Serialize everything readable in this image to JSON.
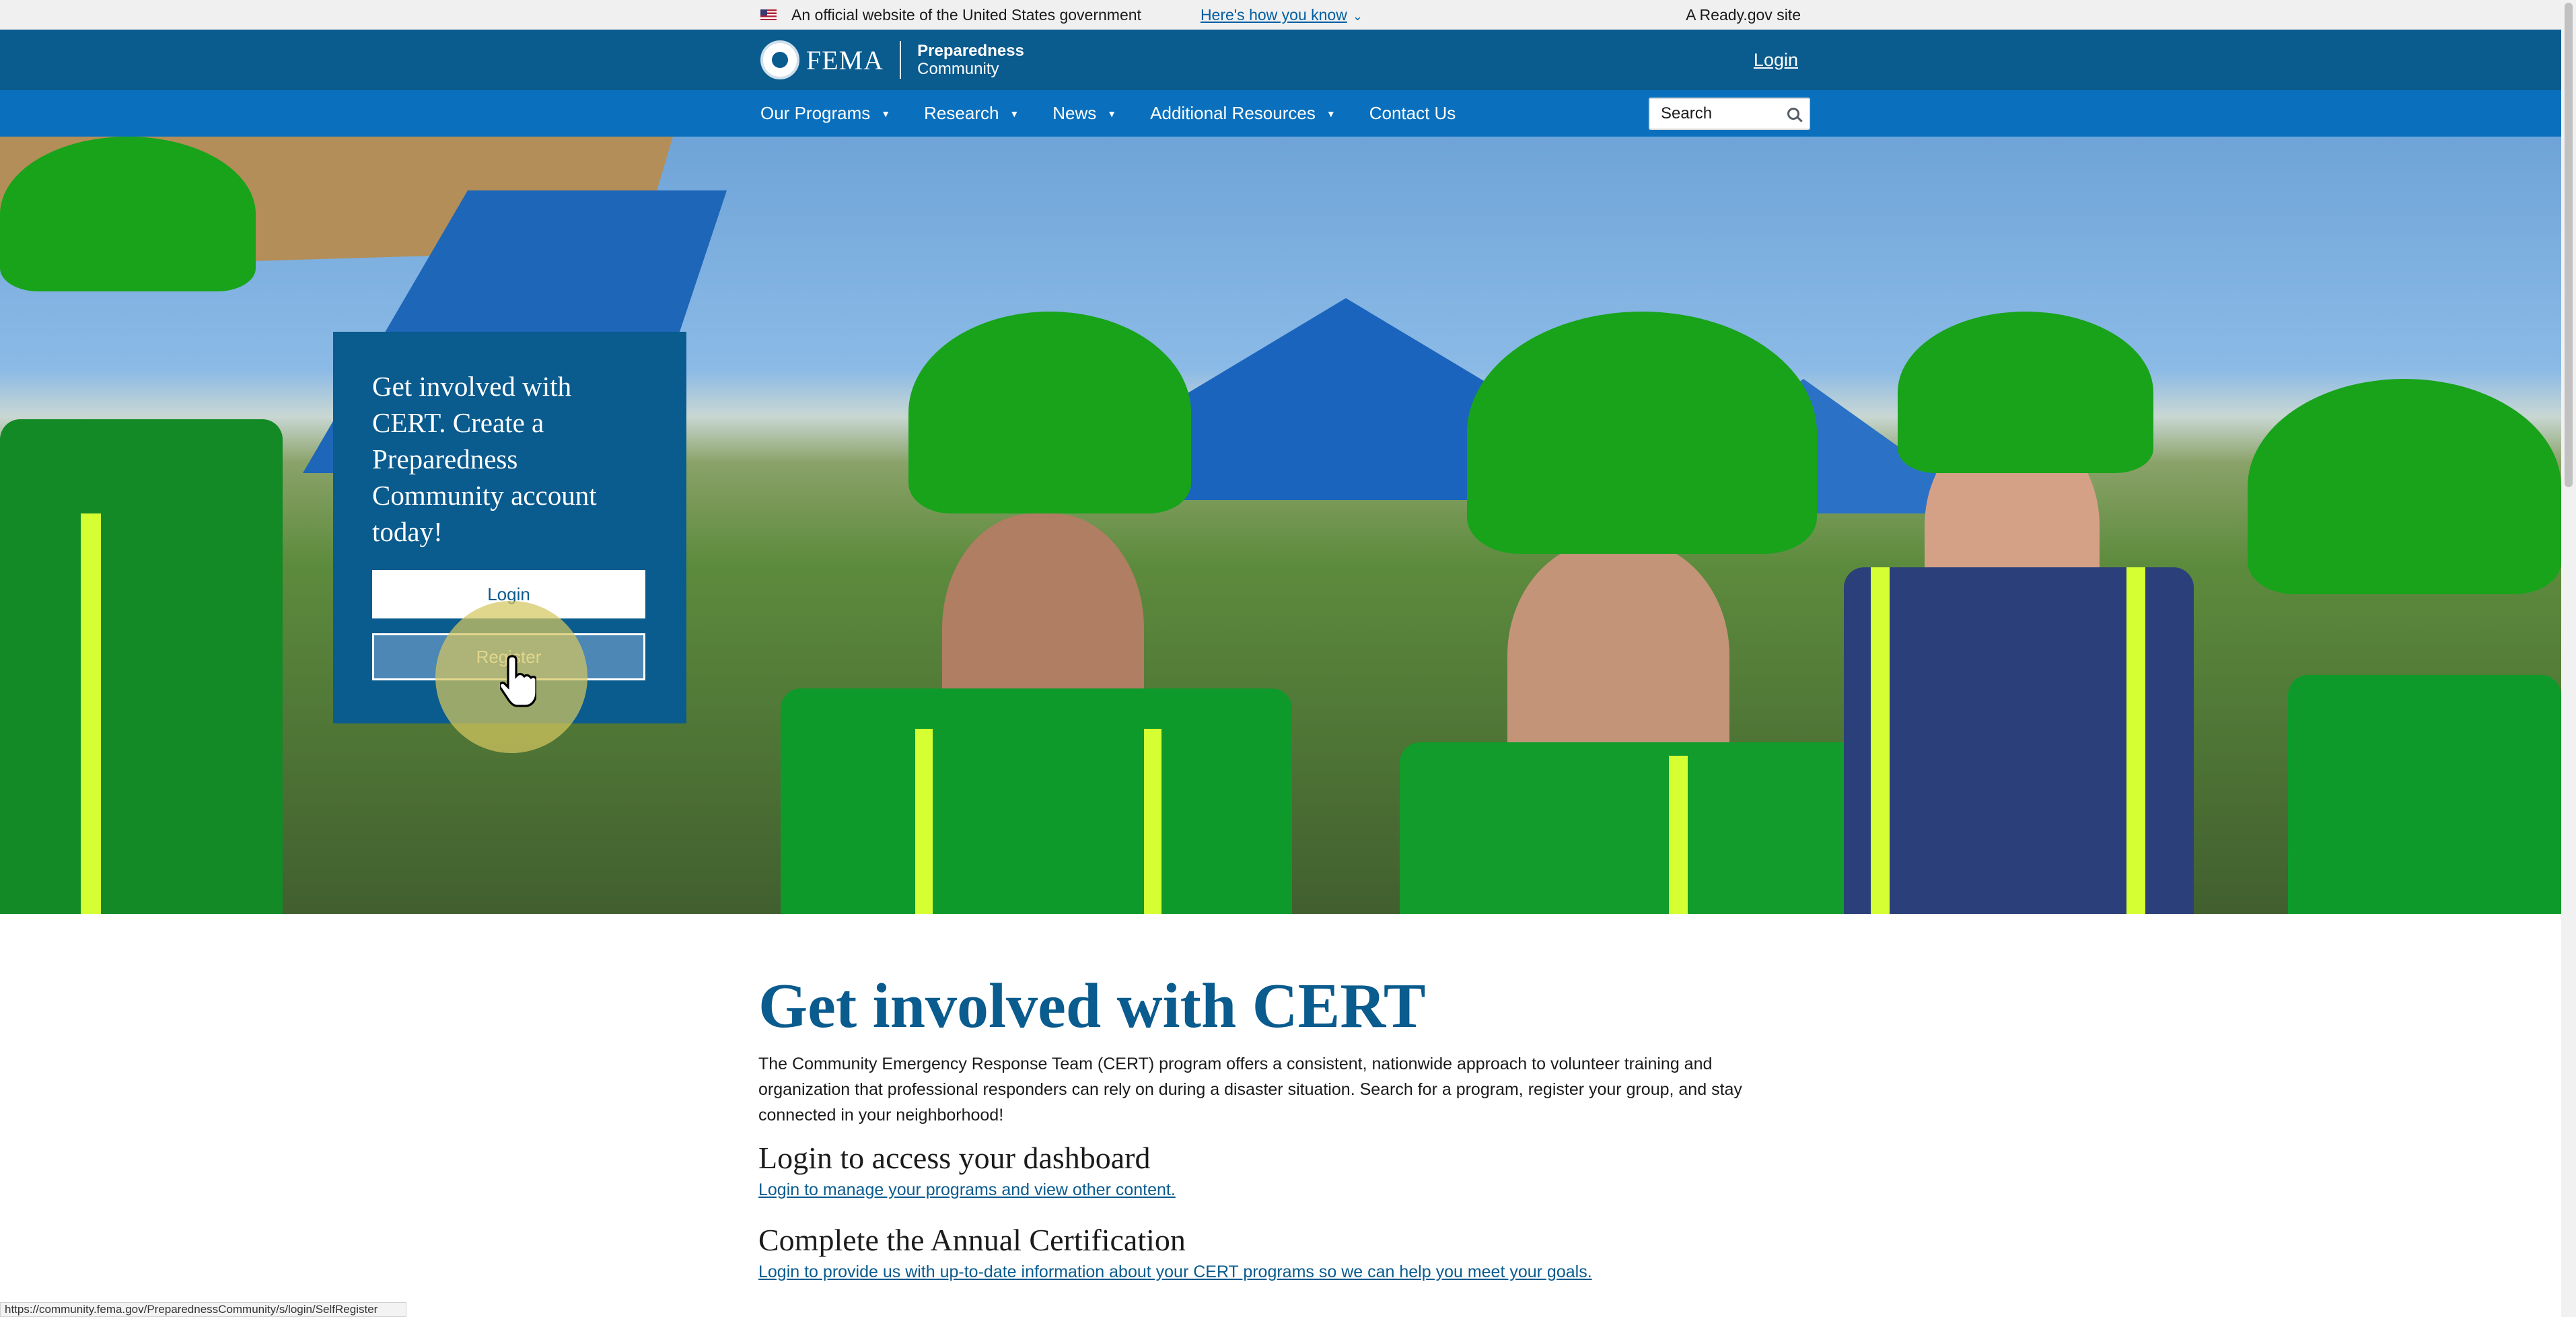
{
  "gov_banner": {
    "official_text": "An official website of the United States government",
    "how_you_know": "Here's how you know",
    "ready_site": "A Ready.gov site"
  },
  "header": {
    "agency": "FEMA",
    "site_name_line1": "Preparedness",
    "site_name_line2": "Community",
    "login": "Login"
  },
  "nav": {
    "items": [
      {
        "label": "Our Programs",
        "has_dropdown": true
      },
      {
        "label": "Research",
        "has_dropdown": true
      },
      {
        "label": "News",
        "has_dropdown": true
      },
      {
        "label": "Additional Resources",
        "has_dropdown": true
      },
      {
        "label": "Contact Us",
        "has_dropdown": false
      }
    ],
    "search_placeholder": "Search"
  },
  "hero": {
    "heading": "Get involved with CERT. Create a Preparedness Community account today!",
    "login_button": "Login",
    "register_button": "Register"
  },
  "content": {
    "title": "Get involved with CERT",
    "intro": "The Community Emergency Response Team (CERT) program offers a consistent, nationwide approach to volunteer training and organization that professional responders can rely on during a disaster situation. Search for a program, register your group, and stay connected in your neighborhood!",
    "dashboard_heading": "Login to access your dashboard",
    "dashboard_link": "Login to manage your programs and view other content.",
    "certification_heading": "Complete the Annual Certification",
    "certification_link": "Login to provide us with up-to-date information about your CERT programs so we can help you meet your goals."
  },
  "status_bar": {
    "url": "https://community.fema.gov/PreparednessCommunity/s/login/SelfRegister"
  },
  "colors": {
    "header_blue": "#0a5b8e",
    "nav_blue": "#0a70bd",
    "link_blue": "#005ea2",
    "helmet_green": "#18a31b"
  }
}
